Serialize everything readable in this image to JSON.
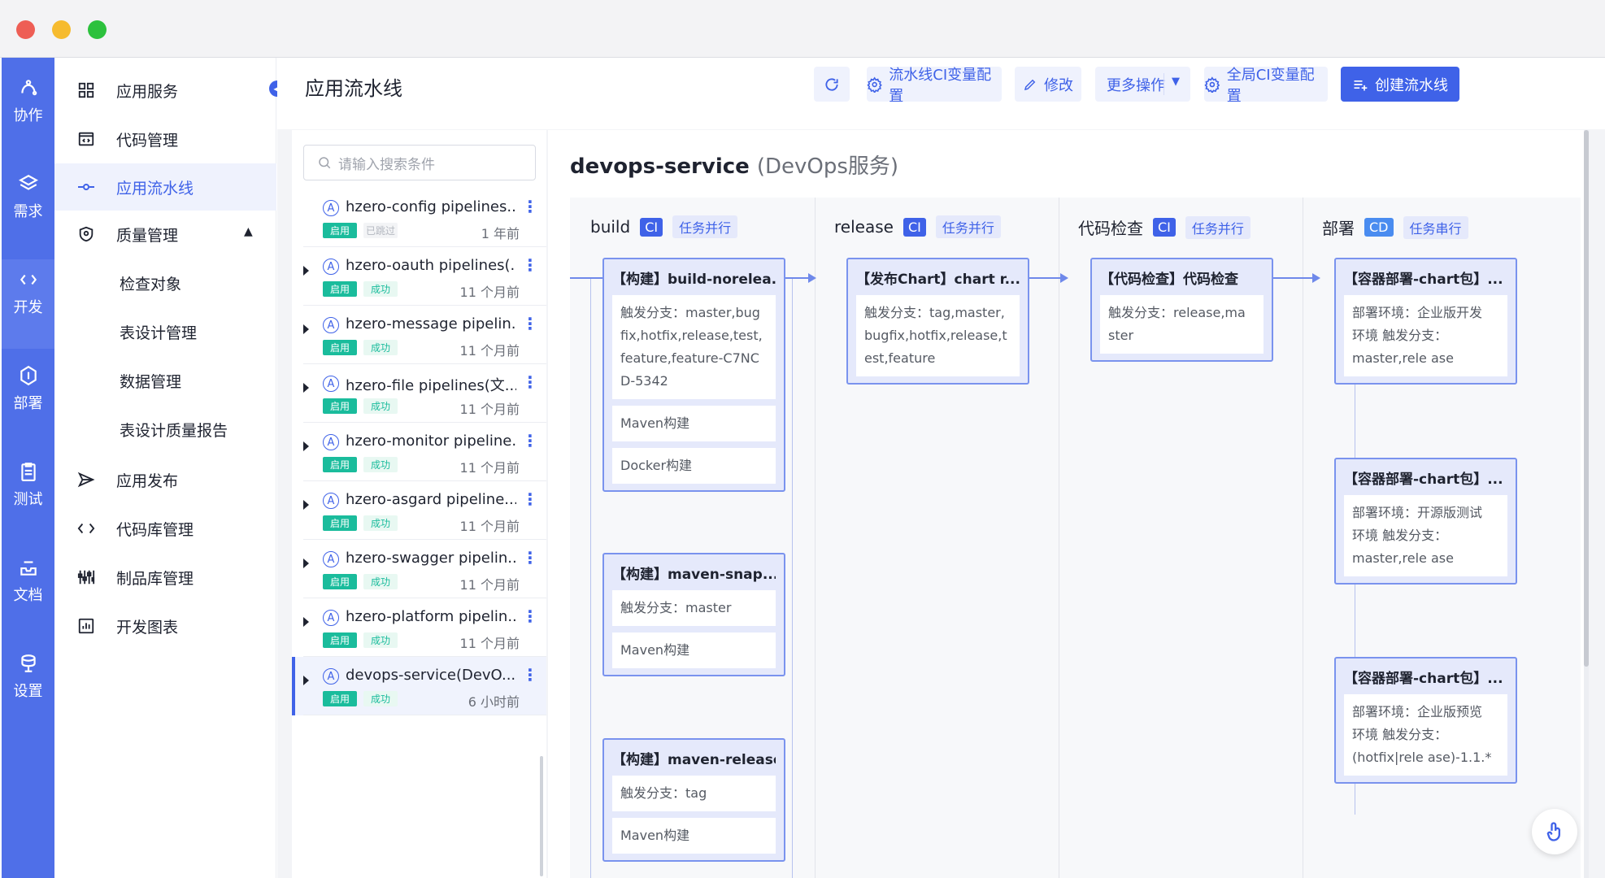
{
  "rail": {
    "items": [
      {
        "label": "协作",
        "icon": "collaboration-icon"
      },
      {
        "label": "需求",
        "icon": "layers-icon"
      },
      {
        "label": "开发",
        "icon": "code-dev-icon"
      },
      {
        "label": "部署",
        "icon": "cube-icon"
      },
      {
        "label": "测试",
        "icon": "clipboard-icon"
      },
      {
        "label": "文档",
        "icon": "inbox-icon"
      },
      {
        "label": "设置",
        "icon": "database-icon"
      }
    ]
  },
  "sidebar": {
    "items": [
      {
        "label": "应用服务",
        "icon": "grid-icon"
      },
      {
        "label": "代码管理",
        "icon": "code-window-icon"
      },
      {
        "label": "应用流水线",
        "icon": "pipeline-icon",
        "active": true
      },
      {
        "label": "质量管理",
        "icon": "shield-icon",
        "expanded": true
      }
    ],
    "quality_sub": [
      "检查对象",
      "表设计管理",
      "数据管理",
      "表设计质量报告"
    ],
    "more": [
      {
        "label": "应用发布",
        "icon": "send-icon"
      },
      {
        "label": "代码库管理",
        "icon": "code-brackets-icon"
      },
      {
        "label": "制品库管理",
        "icon": "sliders-icon"
      },
      {
        "label": "开发图表",
        "icon": "chart-icon"
      }
    ]
  },
  "header": {
    "title": "应用流水线",
    "buttons": {
      "ci_vars": "流水线CI变量配置",
      "edit": "修改",
      "more": "更多操作",
      "global_ci": "全局CI变量配置",
      "create": "创建流水线"
    }
  },
  "list": {
    "search_placeholder": "请输入搜索条件",
    "pipelines": [
      {
        "name": "hzero-config pipelines...",
        "enabled": "启用",
        "status": "已跳过",
        "time": "1 年前"
      },
      {
        "name": "hzero-oauth pipelines(...",
        "enabled": "启用",
        "status": "成功",
        "time": "11 个月前"
      },
      {
        "name": "hzero-message pipelin...",
        "enabled": "启用",
        "status": "成功",
        "time": "11 个月前"
      },
      {
        "name": "hzero-file pipelines(文...",
        "enabled": "启用",
        "status": "成功",
        "time": "11 个月前"
      },
      {
        "name": "hzero-monitor pipeline...",
        "enabled": "启用",
        "status": "成功",
        "time": "11 个月前"
      },
      {
        "name": "hzero-asgard pipeline...",
        "enabled": "启用",
        "status": "成功",
        "time": "11 个月前"
      },
      {
        "name": "hzero-swagger pipelin...",
        "enabled": "启用",
        "status": "成功",
        "time": "11 个月前"
      },
      {
        "name": "hzero-platform pipelin...",
        "enabled": "启用",
        "status": "成功",
        "time": "11 个月前"
      },
      {
        "name": "devops-service(DevO...",
        "enabled": "启用",
        "status": "成功",
        "time": "6 小时前"
      }
    ]
  },
  "detail": {
    "name": "devops-service",
    "subtitle": "(DevOps服务)",
    "stages": [
      {
        "name": "build",
        "type": "CI",
        "mode": "任务并行"
      },
      {
        "name": "release",
        "type": "CI",
        "mode": "任务并行"
      },
      {
        "name": "代码检查",
        "type": "CI",
        "mode": "任务并行"
      },
      {
        "name": "部署",
        "type": "CD",
        "mode": "任务串行"
      }
    ],
    "jobs": {
      "build1": {
        "title": "【构建】build-norelea...",
        "lines": [
          "触发分支：master,bug fix,hotfix,release,test, feature,feature-C7NC D-5342",
          "Maven构建",
          "Docker构建"
        ]
      },
      "build2": {
        "title": "【构建】maven-snap...",
        "lines": [
          "触发分支：master",
          "Maven构建"
        ]
      },
      "build3": {
        "title": "【构建】maven-release",
        "lines": [
          "触发分支：tag",
          "Maven构建"
        ]
      },
      "release1": {
        "title": "【发布Chart】chart r...",
        "lines": [
          "触发分支：tag,master, bugfix,hotfix,release,t est,feature"
        ]
      },
      "check1": {
        "title": "【代码检查】代码检查",
        "lines": [
          "触发分支：release,ma ster"
        ]
      },
      "deploy1": {
        "title": "【容器部署-chart包】...",
        "lines": [
          "部署环境：企业版开发 环境 触发分支：master,rele ase"
        ]
      },
      "deploy2": {
        "title": "【容器部署-chart包】...",
        "lines": [
          "部署环境：开源版测试 环境 触发分支：master,rele ase"
        ]
      },
      "deploy3": {
        "title": "【容器部署-chart包】...",
        "lines": [
          "部署环境：企业版预览 环境 触发分支：(hotfix|rele ase)-1.1.*"
        ]
      }
    }
  },
  "colors": {
    "primary": "#3f62e8",
    "rail": "#4f6fe8",
    "success": "#1abc9c"
  }
}
